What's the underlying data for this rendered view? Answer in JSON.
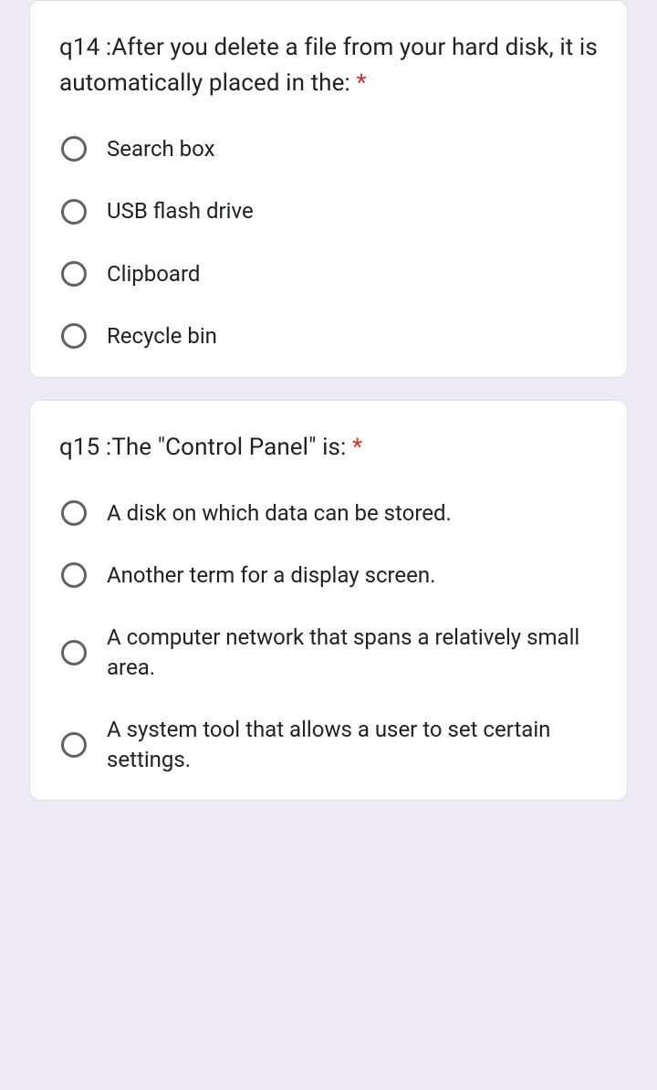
{
  "required_marker": "*",
  "questions": [
    {
      "text": "q14 :After you delete a file from your hard disk, it is automatically placed in the: ",
      "options": [
        "Search box",
        "USB flash drive",
        "Clipboard",
        "Recycle bin"
      ]
    },
    {
      "text": "q15 :The \"Control Panel\" is: ",
      "options": [
        "A disk on which data can be stored.",
        "Another term for a display screen.",
        "A computer network that spans a relatively small area.",
        "A system tool that allows a user to set certain settings."
      ]
    }
  ]
}
